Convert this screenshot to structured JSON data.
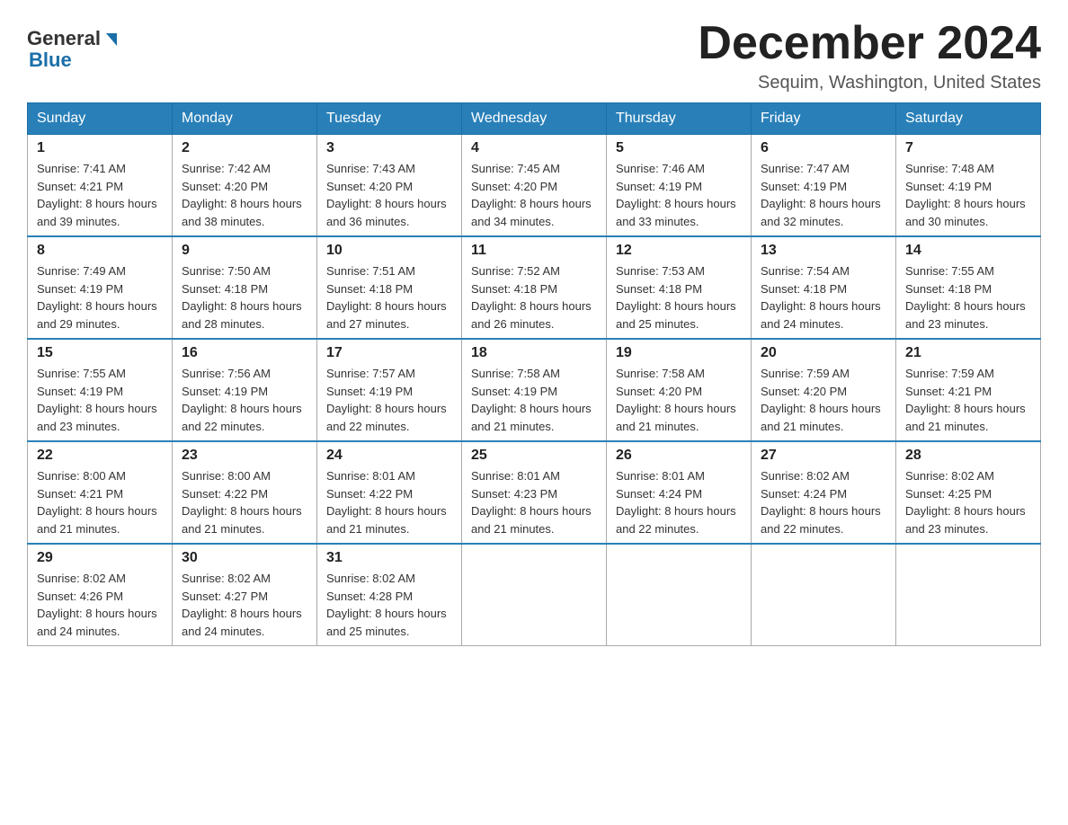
{
  "header": {
    "logo_general": "General",
    "logo_blue": "Blue",
    "month_title": "December 2024",
    "location": "Sequim, Washington, United States"
  },
  "weekdays": [
    "Sunday",
    "Monday",
    "Tuesday",
    "Wednesday",
    "Thursday",
    "Friday",
    "Saturday"
  ],
  "weeks": [
    [
      {
        "day": "1",
        "sunrise": "7:41 AM",
        "sunset": "4:21 PM",
        "daylight": "8 hours and 39 minutes."
      },
      {
        "day": "2",
        "sunrise": "7:42 AM",
        "sunset": "4:20 PM",
        "daylight": "8 hours and 38 minutes."
      },
      {
        "day": "3",
        "sunrise": "7:43 AM",
        "sunset": "4:20 PM",
        "daylight": "8 hours and 36 minutes."
      },
      {
        "day": "4",
        "sunrise": "7:45 AM",
        "sunset": "4:20 PM",
        "daylight": "8 hours and 34 minutes."
      },
      {
        "day": "5",
        "sunrise": "7:46 AM",
        "sunset": "4:19 PM",
        "daylight": "8 hours and 33 minutes."
      },
      {
        "day": "6",
        "sunrise": "7:47 AM",
        "sunset": "4:19 PM",
        "daylight": "8 hours and 32 minutes."
      },
      {
        "day": "7",
        "sunrise": "7:48 AM",
        "sunset": "4:19 PM",
        "daylight": "8 hours and 30 minutes."
      }
    ],
    [
      {
        "day": "8",
        "sunrise": "7:49 AM",
        "sunset": "4:19 PM",
        "daylight": "8 hours and 29 minutes."
      },
      {
        "day": "9",
        "sunrise": "7:50 AM",
        "sunset": "4:18 PM",
        "daylight": "8 hours and 28 minutes."
      },
      {
        "day": "10",
        "sunrise": "7:51 AM",
        "sunset": "4:18 PM",
        "daylight": "8 hours and 27 minutes."
      },
      {
        "day": "11",
        "sunrise": "7:52 AM",
        "sunset": "4:18 PM",
        "daylight": "8 hours and 26 minutes."
      },
      {
        "day": "12",
        "sunrise": "7:53 AM",
        "sunset": "4:18 PM",
        "daylight": "8 hours and 25 minutes."
      },
      {
        "day": "13",
        "sunrise": "7:54 AM",
        "sunset": "4:18 PM",
        "daylight": "8 hours and 24 minutes."
      },
      {
        "day": "14",
        "sunrise": "7:55 AM",
        "sunset": "4:18 PM",
        "daylight": "8 hours and 23 minutes."
      }
    ],
    [
      {
        "day": "15",
        "sunrise": "7:55 AM",
        "sunset": "4:19 PM",
        "daylight": "8 hours and 23 minutes."
      },
      {
        "day": "16",
        "sunrise": "7:56 AM",
        "sunset": "4:19 PM",
        "daylight": "8 hours and 22 minutes."
      },
      {
        "day": "17",
        "sunrise": "7:57 AM",
        "sunset": "4:19 PM",
        "daylight": "8 hours and 22 minutes."
      },
      {
        "day": "18",
        "sunrise": "7:58 AM",
        "sunset": "4:19 PM",
        "daylight": "8 hours and 21 minutes."
      },
      {
        "day": "19",
        "sunrise": "7:58 AM",
        "sunset": "4:20 PM",
        "daylight": "8 hours and 21 minutes."
      },
      {
        "day": "20",
        "sunrise": "7:59 AM",
        "sunset": "4:20 PM",
        "daylight": "8 hours and 21 minutes."
      },
      {
        "day": "21",
        "sunrise": "7:59 AM",
        "sunset": "4:21 PM",
        "daylight": "8 hours and 21 minutes."
      }
    ],
    [
      {
        "day": "22",
        "sunrise": "8:00 AM",
        "sunset": "4:21 PM",
        "daylight": "8 hours and 21 minutes."
      },
      {
        "day": "23",
        "sunrise": "8:00 AM",
        "sunset": "4:22 PM",
        "daylight": "8 hours and 21 minutes."
      },
      {
        "day": "24",
        "sunrise": "8:01 AM",
        "sunset": "4:22 PM",
        "daylight": "8 hours and 21 minutes."
      },
      {
        "day": "25",
        "sunrise": "8:01 AM",
        "sunset": "4:23 PM",
        "daylight": "8 hours and 21 minutes."
      },
      {
        "day": "26",
        "sunrise": "8:01 AM",
        "sunset": "4:24 PM",
        "daylight": "8 hours and 22 minutes."
      },
      {
        "day": "27",
        "sunrise": "8:02 AM",
        "sunset": "4:24 PM",
        "daylight": "8 hours and 22 minutes."
      },
      {
        "day": "28",
        "sunrise": "8:02 AM",
        "sunset": "4:25 PM",
        "daylight": "8 hours and 23 minutes."
      }
    ],
    [
      {
        "day": "29",
        "sunrise": "8:02 AM",
        "sunset": "4:26 PM",
        "daylight": "8 hours and 24 minutes."
      },
      {
        "day": "30",
        "sunrise": "8:02 AM",
        "sunset": "4:27 PM",
        "daylight": "8 hours and 24 minutes."
      },
      {
        "day": "31",
        "sunrise": "8:02 AM",
        "sunset": "4:28 PM",
        "daylight": "8 hours and 25 minutes."
      },
      null,
      null,
      null,
      null
    ]
  ],
  "labels": {
    "sunrise_prefix": "Sunrise: ",
    "sunset_prefix": "Sunset: ",
    "daylight_prefix": "Daylight: "
  }
}
